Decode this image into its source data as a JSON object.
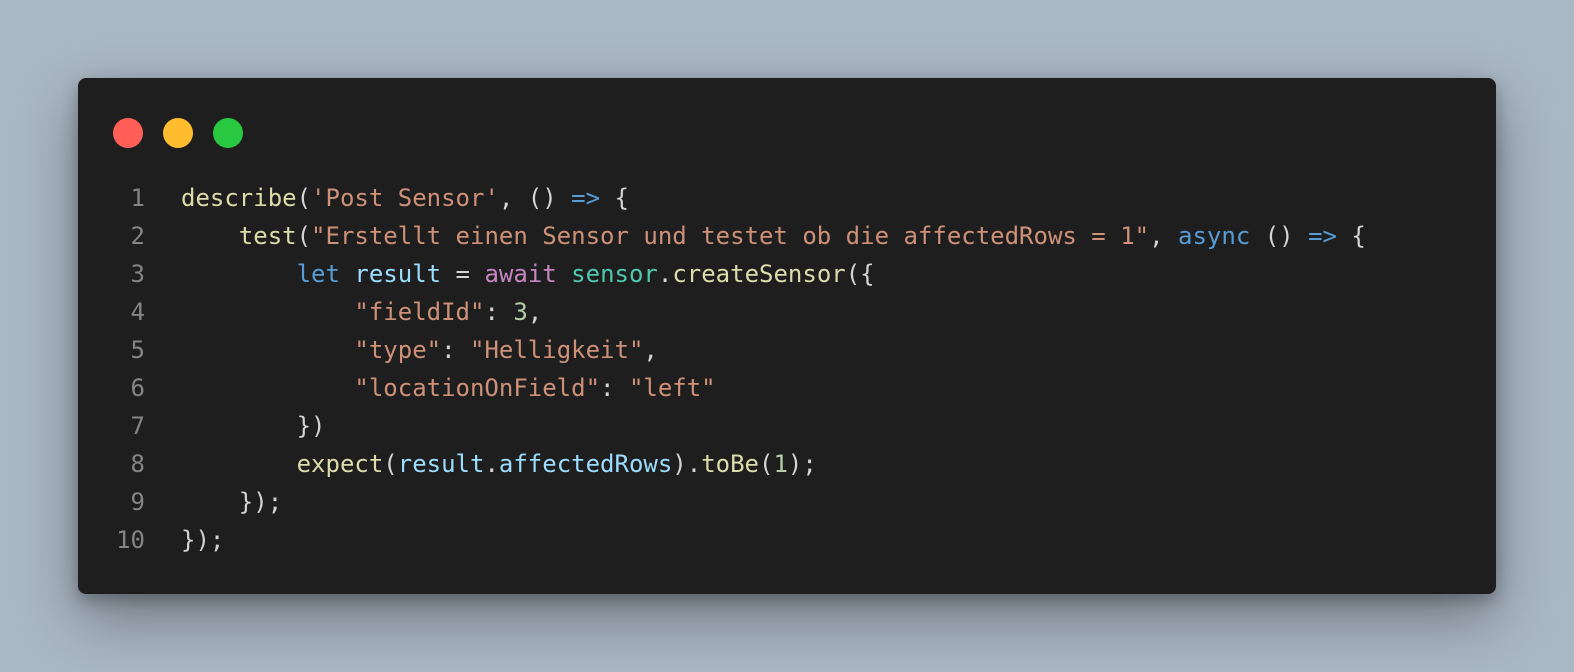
{
  "window": {
    "controls": [
      {
        "name": "close",
        "color": "#ff5f57"
      },
      {
        "name": "minimize",
        "color": "#febc2e"
      },
      {
        "name": "maximize",
        "color": "#28c840"
      }
    ]
  },
  "theme": {
    "background": "#1e1e1e",
    "line_number": "#858585",
    "default": "#d4d4d4",
    "function": "#dcdcaa",
    "string": "#ce9178",
    "keyword": "#569cd6",
    "control": "#c586c0",
    "variable": "#9cdcfe",
    "number": "#b5cea8",
    "class": "#4ec9b0"
  },
  "code": {
    "lines": [
      {
        "number": "1",
        "tokens": [
          {
            "t": "describe",
            "c": "fn"
          },
          {
            "t": "(",
            "c": "punc"
          },
          {
            "t": "'Post Sensor'",
            "c": "str"
          },
          {
            "t": ", () ",
            "c": "punc"
          },
          {
            "t": "=>",
            "c": "kw"
          },
          {
            "t": " {",
            "c": "punc"
          }
        ]
      },
      {
        "number": "2",
        "tokens": [
          {
            "t": "    ",
            "c": "punc"
          },
          {
            "t": "test",
            "c": "fn"
          },
          {
            "t": "(",
            "c": "punc"
          },
          {
            "t": "\"Erstellt einen Sensor und testet ob die affectedRows = 1\"",
            "c": "str"
          },
          {
            "t": ", ",
            "c": "punc"
          },
          {
            "t": "async",
            "c": "kw"
          },
          {
            "t": " () ",
            "c": "punc"
          },
          {
            "t": "=>",
            "c": "kw"
          },
          {
            "t": " {",
            "c": "punc"
          }
        ]
      },
      {
        "number": "3",
        "tokens": [
          {
            "t": "        ",
            "c": "punc"
          },
          {
            "t": "let",
            "c": "kw"
          },
          {
            "t": " ",
            "c": "punc"
          },
          {
            "t": "result",
            "c": "var"
          },
          {
            "t": " = ",
            "c": "punc"
          },
          {
            "t": "await",
            "c": "ctl"
          },
          {
            "t": " ",
            "c": "punc"
          },
          {
            "t": "sensor",
            "c": "cls"
          },
          {
            "t": ".",
            "c": "punc"
          },
          {
            "t": "createSensor",
            "c": "fn"
          },
          {
            "t": "({",
            "c": "punc"
          }
        ]
      },
      {
        "number": "4",
        "tokens": [
          {
            "t": "            ",
            "c": "punc"
          },
          {
            "t": "\"fieldId\"",
            "c": "str"
          },
          {
            "t": ": ",
            "c": "punc"
          },
          {
            "t": "3",
            "c": "num"
          },
          {
            "t": ",",
            "c": "punc"
          }
        ]
      },
      {
        "number": "5",
        "tokens": [
          {
            "t": "            ",
            "c": "punc"
          },
          {
            "t": "\"type\"",
            "c": "str"
          },
          {
            "t": ": ",
            "c": "punc"
          },
          {
            "t": "\"Helligkeit\"",
            "c": "str"
          },
          {
            "t": ",",
            "c": "punc"
          }
        ]
      },
      {
        "number": "6",
        "tokens": [
          {
            "t": "            ",
            "c": "punc"
          },
          {
            "t": "\"locationOnField\"",
            "c": "str"
          },
          {
            "t": ": ",
            "c": "punc"
          },
          {
            "t": "\"left\"",
            "c": "str"
          }
        ]
      },
      {
        "number": "7",
        "tokens": [
          {
            "t": "        })",
            "c": "punc"
          }
        ]
      },
      {
        "number": "8",
        "tokens": [
          {
            "t": "        ",
            "c": "punc"
          },
          {
            "t": "expect",
            "c": "fn"
          },
          {
            "t": "(",
            "c": "punc"
          },
          {
            "t": "result",
            "c": "var"
          },
          {
            "t": ".",
            "c": "punc"
          },
          {
            "t": "affectedRows",
            "c": "var"
          },
          {
            "t": ").",
            "c": "punc"
          },
          {
            "t": "toBe",
            "c": "fn"
          },
          {
            "t": "(",
            "c": "punc"
          },
          {
            "t": "1",
            "c": "num"
          },
          {
            "t": ");",
            "c": "punc"
          }
        ]
      },
      {
        "number": "9",
        "tokens": [
          {
            "t": "    });",
            "c": "punc"
          }
        ]
      },
      {
        "number": "10",
        "tokens": [
          {
            "t": "});",
            "c": "punc"
          }
        ]
      }
    ]
  }
}
